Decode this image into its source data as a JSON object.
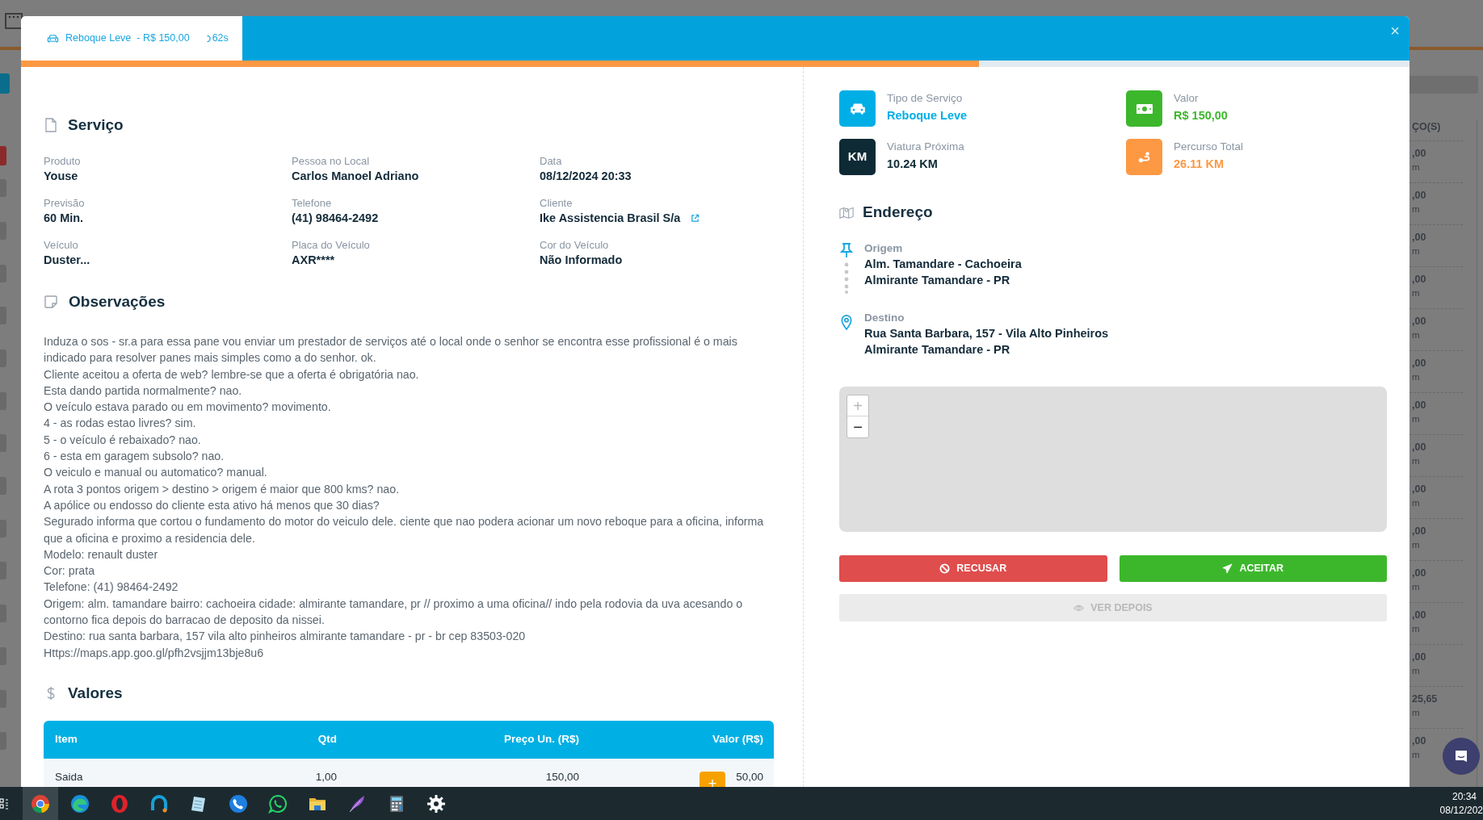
{
  "background": {
    "column_heading": "ÇO(S)",
    "rows": [
      {
        "value": ",00",
        "unit": "m"
      },
      {
        "value": ",00",
        "unit": "m"
      },
      {
        "value": ",00",
        "unit": "m"
      },
      {
        "value": ",00",
        "unit": "m"
      },
      {
        "value": ",00",
        "unit": "m"
      },
      {
        "value": ",00",
        "unit": "m"
      },
      {
        "value": ",00",
        "unit": "m"
      },
      {
        "value": ",00",
        "unit": "m"
      },
      {
        "value": ",00",
        "unit": "m"
      },
      {
        "value": ",00",
        "unit": "m"
      },
      {
        "value": ",00",
        "unit": "m"
      },
      {
        "value": ",00",
        "unit": "m"
      },
      {
        "value": ",00",
        "unit": "m"
      },
      {
        "value": "25,65",
        "unit": "m"
      },
      {
        "value": ",00",
        "unit": "m"
      }
    ]
  },
  "header": {
    "service": "Reboque Leve",
    "price": "- R$ 150,00",
    "timer": "62s",
    "close": "×",
    "level": 0.69
  },
  "service": {
    "title": "Serviço",
    "fields": [
      {
        "label": "Produto",
        "value": "Youse",
        "link": false
      },
      {
        "label": "Pessoa no Local",
        "value": "Carlos Manoel Adriano",
        "link": false
      },
      {
        "label": "Data",
        "value": "08/12/2024 20:33",
        "link": false
      },
      {
        "label": "Previsão",
        "value": "60 Min.",
        "link": false
      },
      {
        "label": "Telefone",
        "value": "(41) 98464-2492",
        "link": false
      },
      {
        "label": "Cliente",
        "value": "Ike Assistencia Brasil S/a",
        "link": true
      },
      {
        "label": "Veículo",
        "value": "Duster...",
        "link": false
      },
      {
        "label": "Placa do Veículo",
        "value": "AXR****",
        "link": false
      },
      {
        "label": "Cor do Veículo",
        "value": "Não Informado",
        "link": false
      }
    ]
  },
  "observations": {
    "title": "Observações",
    "lines": [
      "Induza o sos - sr.a para essa pane vou enviar um prestador de serviços até o local onde o senhor se encontra esse profissional é o mais indicado para resolver panes mais simples como a do senhor. ok.",
      "Cliente aceitou a oferta de web? lembre-se que a oferta é obrigatória nao.",
      "Esta dando partida normalmente? nao.",
      "O veículo estava parado ou em movimento? movimento.",
      "4 - as rodas estao livres? sim.",
      "5 - o veículo é rebaixado? nao.",
      "6 - esta em garagem subsolo? nao.",
      "O veiculo e manual ou automatico? manual.",
      "A rota 3 pontos origem > destino > origem é maior que 800 kms? nao.",
      "A apólice ou endosso do cliente esta ativo há menos que 30 dias?",
      "Segurado informa que cortou o fundamento do motor do veiculo dele. ciente que nao podera acionar um novo reboque para a oficina, informa que a oficina e proximo a residencia dele.",
      "Modelo: renault duster",
      "Cor: prata",
      "Telefone: (41) 98464-2492",
      "Origem: alm. tamandare bairro: cachoeira cidade: almirante tamandare, pr // proximo a uma oficina// indo pela rodovia da uva acesando o contorno fica depois do barracao de deposito da nissei.",
      "Destino: rua santa barbara, 157 vila alto pinheiros almirante tamandare - pr - br cep 83503-020",
      "Https://maps.app.goo.gl/pfh2vsjjm13bje8u6"
    ]
  },
  "values": {
    "title": "Valores",
    "columns": [
      "Item",
      "Qtd",
      "Preço Un. (R$)",
      "Valor (R$)"
    ],
    "rows": [
      [
        "Saida",
        "1,00",
        "150,00",
        "50,00"
      ]
    ],
    "add_button": "+"
  },
  "summary": [
    {
      "kind": "car",
      "label": "Tipo de Serviço",
      "value": "Reboque Leve",
      "color": "#00aee6"
    },
    {
      "kind": "money",
      "label": "Valor",
      "value": "R$ 150,00",
      "color": "#3cb72c"
    },
    {
      "kind": "km",
      "label": "Viatura Próxima",
      "value": "10.24 KM",
      "color": "#0e2a35",
      "icon_text": "KM"
    },
    {
      "kind": "route",
      "label": "Percurso Total",
      "value": "26.11 KM",
      "color": "#fd9843"
    }
  ],
  "address": {
    "title": "Endereço",
    "stops": [
      {
        "kind": "origin",
        "label": "Origem",
        "lines": [
          "Alm. Tamandare - Cachoeira",
          "Almirante Tamandare - PR"
        ]
      },
      {
        "kind": "destination",
        "label": "Destino",
        "lines": [
          "Rua Santa Barbara, 157 - Vila Alto Pinheiros",
          "Almirante Tamandare - PR"
        ]
      }
    ]
  },
  "map": {
    "zoom_in": "+",
    "zoom_out": "−"
  },
  "actions": [
    {
      "kind": "reject",
      "label": "RECUSAR",
      "disabled": false
    },
    {
      "kind": "accept",
      "label": "ACEITAR",
      "disabled": false
    },
    {
      "kind": "later",
      "label": "VER DEPOIS",
      "disabled": true
    }
  ],
  "taskbar": {
    "time": "20:34",
    "date": "08/12/202",
    "apps": [
      {
        "kind": "browser",
        "selected": true
      },
      {
        "kind": "wave",
        "selected": false
      },
      {
        "kind": "ring",
        "selected": false
      },
      {
        "kind": "arc",
        "selected": false
      },
      {
        "kind": "notepad",
        "selected": false
      },
      {
        "kind": "phone",
        "selected": false
      },
      {
        "kind": "chat",
        "selected": false
      },
      {
        "kind": "folder",
        "selected": false
      },
      {
        "kind": "feather",
        "selected": false
      },
      {
        "kind": "calculator",
        "selected": false
      },
      {
        "kind": "gear",
        "selected": false
      }
    ]
  }
}
